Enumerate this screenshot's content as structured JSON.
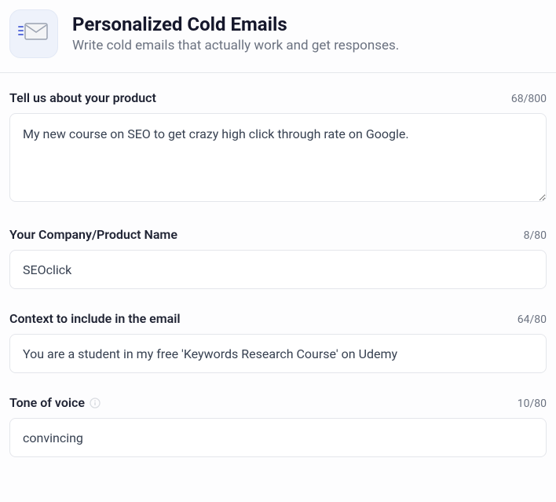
{
  "header": {
    "title": "Personalized Cold Emails",
    "subtitle": "Write cold emails that actually work and get responses."
  },
  "fields": {
    "product": {
      "label": "Tell us about your product",
      "value": "My new course on SEO to get crazy high click through rate on Google.",
      "counter": "68/800"
    },
    "company": {
      "label": "Your Company/Product Name",
      "value": "SEOclick",
      "counter": "8/80"
    },
    "context": {
      "label": "Context to include in the email",
      "value": "You are a student in my free 'Keywords Research Course' on Udemy",
      "counter": "64/80"
    },
    "tone": {
      "label": "Tone of voice",
      "value": "convincing",
      "counter": "10/80"
    }
  }
}
